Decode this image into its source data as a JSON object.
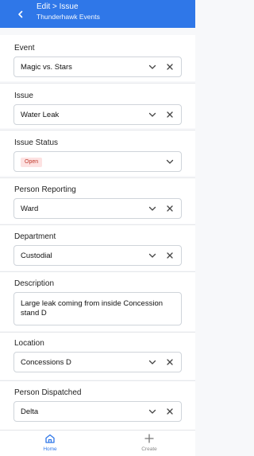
{
  "header": {
    "title": "Edit > Issue",
    "subtitle": "Thunderhawk Events"
  },
  "form": {
    "event": {
      "label": "Event",
      "value": "Magic vs. Stars"
    },
    "issue": {
      "label": "Issue",
      "value": "Water Leak"
    },
    "issue_status": {
      "label": "Issue Status",
      "value": "Open"
    },
    "person_reporting": {
      "label": "Person Reporting",
      "value": "Ward"
    },
    "department": {
      "label": "Department",
      "value": "Custodial"
    },
    "description": {
      "label": "Description",
      "value": "Large leak coming from inside Concession stand D"
    },
    "location": {
      "label": "Location",
      "value": "Concessions D"
    },
    "person_dispatched": {
      "label": "Person Dispatched",
      "value": "Delta"
    }
  },
  "tabs": [
    {
      "label": "Home",
      "icon": "home-icon",
      "active": true
    },
    {
      "label": "Create",
      "icon": "plus-icon",
      "active": false
    }
  ],
  "colors": {
    "accent": "#2f77e8",
    "badge_bg": "#fde2e2",
    "badge_text": "#c0392b"
  }
}
